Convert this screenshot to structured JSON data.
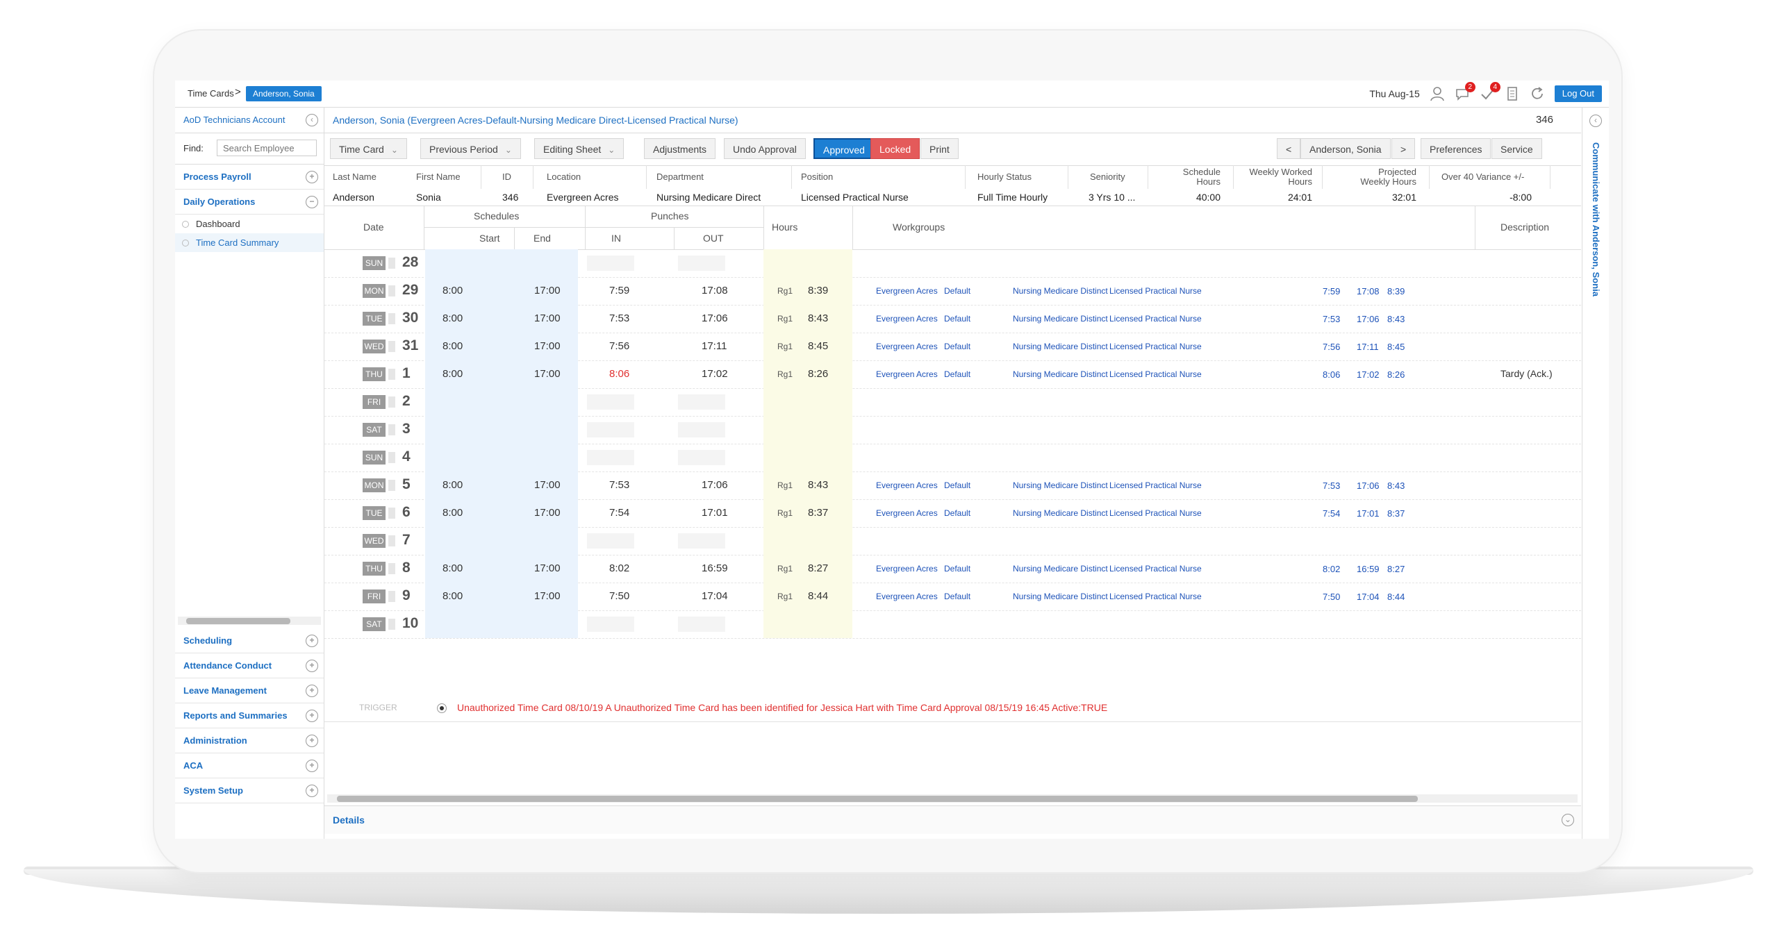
{
  "breadcrumb": {
    "root": "Time Cards",
    "current": "Anderson, Sonia"
  },
  "topbar": {
    "date": "Thu Aug-15",
    "alerts_badge": "2",
    "tasks_badge": "4",
    "logout_label": "Log Out"
  },
  "sidebar": {
    "account": "AoD Technicians Account",
    "find_label": "Find:",
    "search_placeholder": "Search Employee",
    "sections": [
      {
        "label": "Process Payroll"
      },
      {
        "label": "Daily Operations"
      },
      {
        "label": "Scheduling"
      },
      {
        "label": "Attendance Conduct"
      },
      {
        "label": "Leave Management"
      },
      {
        "label": "Reports and Summaries"
      },
      {
        "label": "Administration"
      },
      {
        "label": "ACA"
      },
      {
        "label": "System Setup"
      }
    ],
    "daily_items": [
      {
        "label": "Dashboard"
      },
      {
        "label": "Time Card Summary"
      }
    ]
  },
  "employee_header": {
    "title": "Anderson, Sonia (Evergreen Acres-Default-Nursing Medicare Direct-Licensed Practical Nurse)",
    "number": "346",
    "rail_label": "Communicate with Anderson, Sonia"
  },
  "toolbar": {
    "time_card": "Time Card",
    "previous_period": "Previous Period",
    "editing_sheet": "Editing Sheet",
    "adjustments": "Adjustments",
    "undo_approval": "Undo Approval",
    "approved": "Approved",
    "locked": "Locked",
    "print": "Print",
    "prev": "<",
    "employee": "Anderson, Sonia",
    "next": ">",
    "preferences": "Preferences",
    "service": "Service"
  },
  "employee_info": {
    "headers": {
      "last_name": "Last Name",
      "first_name": "First Name",
      "id": "ID",
      "location": "Location",
      "department": "Department",
      "position": "Position",
      "hourly_status": "Hourly Status",
      "seniority": "Seniority",
      "schedule_hours": "Schedule Hours",
      "weekly_worked": "Weekly Worked Hours",
      "projected_weekly": "Projected Weekly Hours",
      "over40": "Over 40 Variance +/-"
    },
    "values": {
      "last_name": "Anderson",
      "first_name": "Sonia",
      "id": "346",
      "location": "Evergreen Acres",
      "department": "Nursing Medicare Direct",
      "position": "Licensed Practical Nurse",
      "hourly_status": "Full Time Hourly",
      "seniority": "3 Yrs 10 ...",
      "schedule_hours": "40:00",
      "weekly_worked": "24:01",
      "projected_weekly": "32:01",
      "over40": "-8:00"
    }
  },
  "grid_headers": {
    "date": "Date",
    "schedules": "Schedules",
    "start": "Start",
    "end": "End",
    "punches": "Punches",
    "in": "IN",
    "out": "OUT",
    "hours": "Hours",
    "workgroups": "Workgroups",
    "description": "Description"
  },
  "rows": [
    {
      "day": "SUN",
      "num": "28",
      "start": "",
      "end": "",
      "in": "",
      "out": "",
      "rg": "",
      "hours": "",
      "wg_loc": "",
      "wg_def": "",
      "wg_dept": "",
      "wg_pos": "",
      "r_in": "",
      "r_out": "",
      "r_hrs": "",
      "desc": ""
    },
    {
      "day": "MON",
      "num": "29",
      "start": "8:00",
      "end": "17:00",
      "in": "7:59",
      "out": "17:08",
      "rg": "Rg1",
      "hours": "8:39",
      "wg_loc": "Evergreen Acres",
      "wg_def": "Default",
      "wg_dept": "Nursing Medicare Distinct",
      "wg_pos": "Licensed Practical Nurse",
      "r_in": "7:59",
      "r_out": "17:08",
      "r_hrs": "8:39",
      "desc": ""
    },
    {
      "day": "TUE",
      "num": "30",
      "start": "8:00",
      "end": "17:00",
      "in": "7:53",
      "out": "17:06",
      "rg": "Rg1",
      "hours": "8:43",
      "wg_loc": "Evergreen Acres",
      "wg_def": "Default",
      "wg_dept": "Nursing Medicare Distinct",
      "wg_pos": "Licensed Practical Nurse",
      "r_in": "7:53",
      "r_out": "17:06",
      "r_hrs": "8:43",
      "desc": ""
    },
    {
      "day": "WED",
      "num": "31",
      "start": "8:00",
      "end": "17:00",
      "in": "7:56",
      "out": "17:11",
      "rg": "Rg1",
      "hours": "8:45",
      "wg_loc": "Evergreen Acres",
      "wg_def": "Default",
      "wg_dept": "Nursing Medicare Distinct",
      "wg_pos": "Licensed Practical Nurse",
      "r_in": "7:56",
      "r_out": "17:11",
      "r_hrs": "8:45",
      "desc": ""
    },
    {
      "day": "THU",
      "num": "1",
      "start": "8:00",
      "end": "17:00",
      "in": "8:06",
      "out": "17:02",
      "rg": "Rg1",
      "hours": "8:26",
      "wg_loc": "Evergreen Acres",
      "wg_def": "Default",
      "wg_dept": "Nursing Medicare Distinct",
      "wg_pos": "Licensed Practical Nurse",
      "r_in": "8:06",
      "r_out": "17:02",
      "r_hrs": "8:26",
      "desc": "Tardy (Ack.)",
      "late": true
    },
    {
      "day": "FRI",
      "num": "2",
      "start": "",
      "end": "",
      "in": "",
      "out": "",
      "rg": "",
      "hours": "",
      "wg_loc": "",
      "wg_def": "",
      "wg_dept": "",
      "wg_pos": "",
      "r_in": "",
      "r_out": "",
      "r_hrs": "",
      "desc": ""
    },
    {
      "day": "SAT",
      "num": "3",
      "start": "",
      "end": "",
      "in": "",
      "out": "",
      "rg": "",
      "hours": "",
      "wg_loc": "",
      "wg_def": "",
      "wg_dept": "",
      "wg_pos": "",
      "r_in": "",
      "r_out": "",
      "r_hrs": "",
      "desc": ""
    },
    {
      "day": "SUN",
      "num": "4",
      "start": "",
      "end": "",
      "in": "",
      "out": "",
      "rg": "",
      "hours": "",
      "wg_loc": "",
      "wg_def": "",
      "wg_dept": "",
      "wg_pos": "",
      "r_in": "",
      "r_out": "",
      "r_hrs": "",
      "desc": ""
    },
    {
      "day": "MON",
      "num": "5",
      "start": "8:00",
      "end": "17:00",
      "in": "7:53",
      "out": "17:06",
      "rg": "Rg1",
      "hours": "8:43",
      "wg_loc": "Evergreen Acres",
      "wg_def": "Default",
      "wg_dept": "Nursing Medicare Distinct",
      "wg_pos": "Licensed Practical Nurse",
      "r_in": "7:53",
      "r_out": "17:06",
      "r_hrs": "8:43",
      "desc": ""
    },
    {
      "day": "TUE",
      "num": "6",
      "start": "8:00",
      "end": "17:00",
      "in": "7:54",
      "out": "17:01",
      "rg": "Rg1",
      "hours": "8:37",
      "wg_loc": "Evergreen Acres",
      "wg_def": "Default",
      "wg_dept": "Nursing Medicare Distinct",
      "wg_pos": "Licensed Practical Nurse",
      "r_in": "7:54",
      "r_out": "17:01",
      "r_hrs": "8:37",
      "desc": ""
    },
    {
      "day": "WED",
      "num": "7",
      "start": "",
      "end": "",
      "in": "",
      "out": "",
      "rg": "",
      "hours": "",
      "wg_loc": "",
      "wg_def": "",
      "wg_dept": "",
      "wg_pos": "",
      "r_in": "",
      "r_out": "",
      "r_hrs": "",
      "desc": ""
    },
    {
      "day": "THU",
      "num": "8",
      "start": "8:00",
      "end": "17:00",
      "in": "8:02",
      "out": "16:59",
      "rg": "Rg1",
      "hours": "8:27",
      "wg_loc": "Evergreen Acres",
      "wg_def": "Default",
      "wg_dept": "Nursing Medicare Distinct",
      "wg_pos": "Licensed Practical Nurse",
      "r_in": "8:02",
      "r_out": "16:59",
      "r_hrs": "8:27",
      "desc": ""
    },
    {
      "day": "FRI",
      "num": "9",
      "start": "8:00",
      "end": "17:00",
      "in": "7:50",
      "out": "17:04",
      "rg": "Rg1",
      "hours": "8:44",
      "wg_loc": "Evergreen Acres",
      "wg_def": "Default",
      "wg_dept": "Nursing Medicare Distinct",
      "wg_pos": "Licensed Practical Nurse",
      "r_in": "7:50",
      "r_out": "17:04",
      "r_hrs": "8:44",
      "desc": ""
    },
    {
      "day": "SAT",
      "num": "10",
      "start": "",
      "end": "",
      "in": "",
      "out": "",
      "rg": "",
      "hours": "",
      "wg_loc": "",
      "wg_def": "",
      "wg_dept": "",
      "wg_pos": "",
      "r_in": "",
      "r_out": "",
      "r_hrs": "",
      "desc": ""
    }
  ],
  "trigger": {
    "label": "TRIGGER",
    "message": "Unauthorized Time Card 08/10/19 A Unauthorized Time Card has been identified for Jessica Hart with Time Card Approval 08/15/19 16:45 Active:TRUE"
  },
  "details": {
    "label": "Details"
  },
  "colors": {
    "accent": "#1d7fd3",
    "link": "#1d6fc2",
    "locked": "#e45a5a",
    "late": "#e03030"
  }
}
